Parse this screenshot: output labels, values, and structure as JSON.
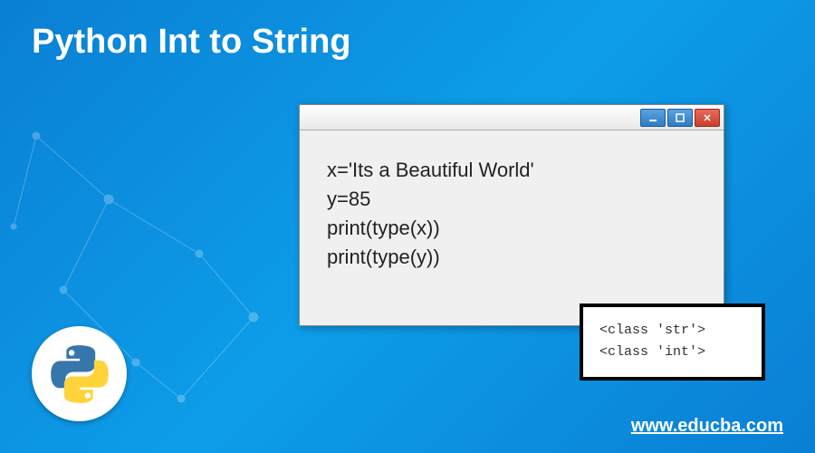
{
  "title": "Python Int to String",
  "code": {
    "line1": "x='Its a Beautiful World'",
    "line2": "y=85",
    "line3": "print(type(x))",
    "line4": "print(type(y))"
  },
  "output": {
    "line1": "<class 'str'>",
    "line2": "<class 'int'>"
  },
  "website": "www.educba.com",
  "icons": {
    "minimize": "minimize-icon",
    "maximize": "maximize-icon",
    "close": "close-icon",
    "python": "python-logo-icon"
  }
}
